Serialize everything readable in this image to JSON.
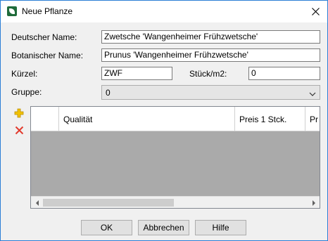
{
  "window": {
    "title": "Neue Pflanze"
  },
  "form": {
    "deutscher_name": {
      "label": "Deutscher Name:",
      "value": "Zwetsche 'Wangenheimer Frühzwetsche'"
    },
    "botanischer_name": {
      "label": "Botanischer Name:",
      "value": "Prunus 'Wangenheimer Frühzwetsche'"
    },
    "kuerzel": {
      "label": "Kürzel:",
      "value": "ZWF"
    },
    "stueck_m2": {
      "label": "Stück/m2:",
      "value": "0"
    },
    "gruppe": {
      "label": "Gruppe:",
      "value": "0"
    }
  },
  "grid": {
    "columns": [
      "Qualität",
      "Preis 1 Stck.",
      "Pr"
    ]
  },
  "buttons": {
    "ok": "OK",
    "cancel": "Abbrechen",
    "help": "Hilfe"
  },
  "icons": {
    "app": "plant-app-icon",
    "close": "close-icon",
    "add": "plus-icon",
    "delete": "red-x-icon"
  },
  "colors": {
    "add": "#f2c200",
    "delete": "#e23b2e",
    "grid_empty": "#aaaaaa"
  }
}
